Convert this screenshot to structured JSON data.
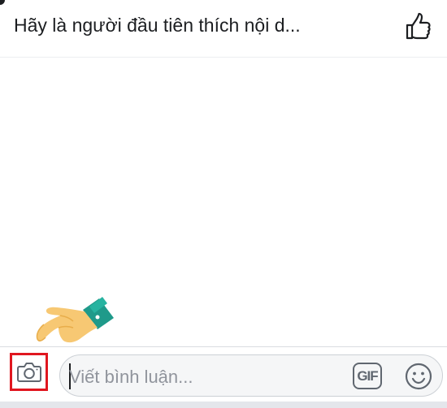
{
  "header": {
    "title": "Hãy là người đầu tiên thích nội d...",
    "like_icon": "thumbs-up-icon"
  },
  "composer": {
    "camera_icon": "camera-icon",
    "placeholder": "Viết bình luận...",
    "gif_label": "GIF",
    "emoji_icon": "smiley-icon"
  },
  "annotation": {
    "pointer_icon": "pointing-hand-icon",
    "highlight_color": "#e0161f"
  },
  "colors": {
    "text": "#1c1e21",
    "placeholder": "#90949c",
    "icon": "#606770",
    "hand_skin": "#f7c873",
    "cuff": "#1f9a8a"
  }
}
